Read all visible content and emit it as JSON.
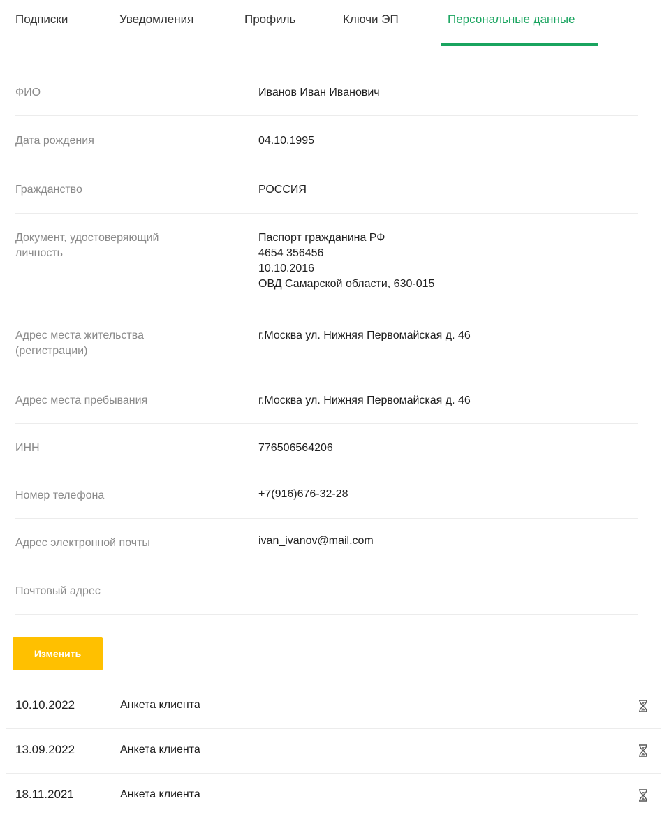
{
  "tabs": [
    {
      "label": "Подписки"
    },
    {
      "label": "Уведомления"
    },
    {
      "label": "Профиль"
    },
    {
      "label": "Ключи ЭП"
    },
    {
      "label": "Персональные данные",
      "active": true
    }
  ],
  "accent_color": "#19a45f",
  "button_color": "#ffc000",
  "fields": [
    {
      "label": "ФИО",
      "value": "Иванов Иван Иванович"
    },
    {
      "label": "Дата рождения",
      "value": "04.10.1995"
    },
    {
      "label": "Гражданство",
      "value": "РОССИЯ"
    },
    {
      "label": "Документ, удостоверяющий\nличность",
      "value": "Паспорт гражданина РФ\n4654 356456\n10.10.2016\nОВД Самарской области, 630-015"
    },
    {
      "label": "Адрес места жительства\n(регистрации)",
      "value": "г.Москва ул. Нижняя Первомайская д. 46"
    },
    {
      "label": "Адрес места пребывания",
      "value": "г.Москва ул. Нижняя Первомайская д. 46"
    },
    {
      "label": "ИНН",
      "value": "776506564206"
    },
    {
      "label": "Номер телефона",
      "value": "+7(916)676-32-28"
    },
    {
      "label": "Адрес электронной почты",
      "value": "ivan_ivanov@mail.com"
    },
    {
      "label": "Почтовый адрес",
      "value": ""
    }
  ],
  "edit_button": {
    "label": "Изменить"
  },
  "history": [
    {
      "date": "10.10.2022",
      "document": "Анкета клиента",
      "icon": "hourglass-icon"
    },
    {
      "date": "13.09.2022",
      "document": "Анкета клиента",
      "icon": "hourglass-icon"
    },
    {
      "date": "18.11.2021",
      "document": "Анкета клиента",
      "icon": "hourglass-icon"
    }
  ]
}
